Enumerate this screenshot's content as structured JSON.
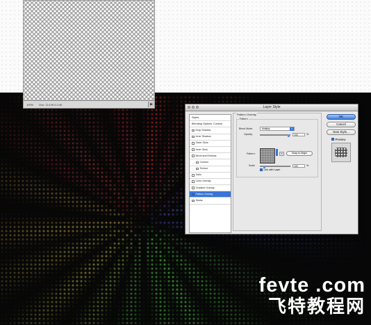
{
  "pattern_document": {
    "zoom": "100%",
    "doc_size": "Doc: 114.0K/1.14K"
  },
  "dialog": {
    "title": "Layer Style",
    "styles_list": [
      {
        "label": "Styles",
        "checkbox": false,
        "checked": false,
        "indent": false,
        "selected": false
      },
      {
        "label": "Blending Options: Custom",
        "checkbox": false,
        "checked": false,
        "indent": false,
        "selected": false
      },
      {
        "label": "Drop Shadow",
        "checkbox": true,
        "checked": false,
        "indent": false,
        "selected": false
      },
      {
        "label": "Inner Shadow",
        "checkbox": true,
        "checked": false,
        "indent": false,
        "selected": false
      },
      {
        "label": "Outer Glow",
        "checkbox": true,
        "checked": false,
        "indent": false,
        "selected": false
      },
      {
        "label": "Inner Glow",
        "checkbox": true,
        "checked": false,
        "indent": false,
        "selected": false
      },
      {
        "label": "Bevel and Emboss",
        "checkbox": true,
        "checked": false,
        "indent": false,
        "selected": false
      },
      {
        "label": "Contour",
        "checkbox": true,
        "checked": false,
        "indent": true,
        "selected": false
      },
      {
        "label": "Texture",
        "checkbox": true,
        "checked": false,
        "indent": true,
        "selected": false
      },
      {
        "label": "Satin",
        "checkbox": true,
        "checked": false,
        "indent": false,
        "selected": false
      },
      {
        "label": "Color Overlay",
        "checkbox": true,
        "checked": false,
        "indent": false,
        "selected": false
      },
      {
        "label": "Gradient Overlay",
        "checkbox": true,
        "checked": false,
        "indent": false,
        "selected": false
      },
      {
        "label": "Pattern Overlay",
        "checkbox": true,
        "checked": true,
        "indent": false,
        "selected": true
      },
      {
        "label": "Stroke",
        "checkbox": true,
        "checked": false,
        "indent": false,
        "selected": false
      }
    ],
    "section_title": "Pattern Overlay",
    "group_title": "Pattern",
    "blend_mode_label": "Blend Mode:",
    "blend_mode_value": "Multiply",
    "opacity_label": "Opacity",
    "opacity_value": "100",
    "opacity_level": 1.0,
    "pattern_label": "Pattern:",
    "snap_button": "Snap to Origin",
    "scale_label": "Scale",
    "scale_value": "100",
    "scale_level": 0.1,
    "percent": "%",
    "link_label": "Link with Layer",
    "buttons": {
      "ok": "OK",
      "cancel": "Cancel",
      "new_style": "New Style...",
      "preview": "Preview"
    }
  },
  "watermark": {
    "line1": "fevte .com",
    "line2": "飞特教程网"
  },
  "colors": {
    "accent": "#3875d7",
    "background": "#0a0a0a"
  }
}
